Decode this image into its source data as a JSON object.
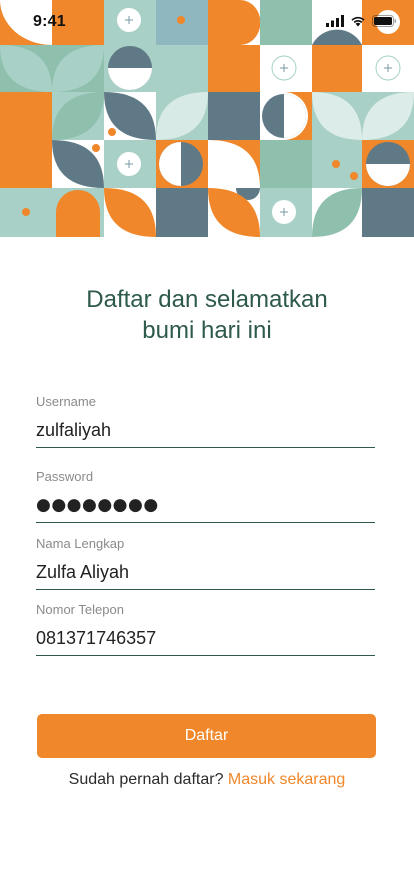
{
  "status_bar": {
    "time": "9:41"
  },
  "hero": {
    "colors": {
      "orange": "#f0872a",
      "mint": "#a8d0c6",
      "teal": "#8fc0ae",
      "slate": "#5f7a86",
      "white": "#ffffff"
    },
    "icons": [
      "plus-icon",
      "dot-icon",
      "half-circle-icon",
      "leaf-icon"
    ]
  },
  "title": {
    "line1": "Daftar dan selamatkan",
    "line2": "bumi hari ini"
  },
  "form": {
    "username": {
      "label": "Username",
      "value": "zulfaliyah"
    },
    "password": {
      "label": "Password",
      "value": "●●●●●●●●"
    },
    "fullname": {
      "label": "Nama Lengkap",
      "value": "Zulfa Aliyah"
    },
    "phone": {
      "label": "Nomor Telepon",
      "value": "081371746357"
    }
  },
  "actions": {
    "submit_label": "Daftar",
    "login_prompt": "Sudah pernah daftar?",
    "login_link": "Masuk sekarang"
  },
  "colors": {
    "accent": "#f0872a",
    "title": "#2e5a4a",
    "underline": "#2e5a4a"
  }
}
